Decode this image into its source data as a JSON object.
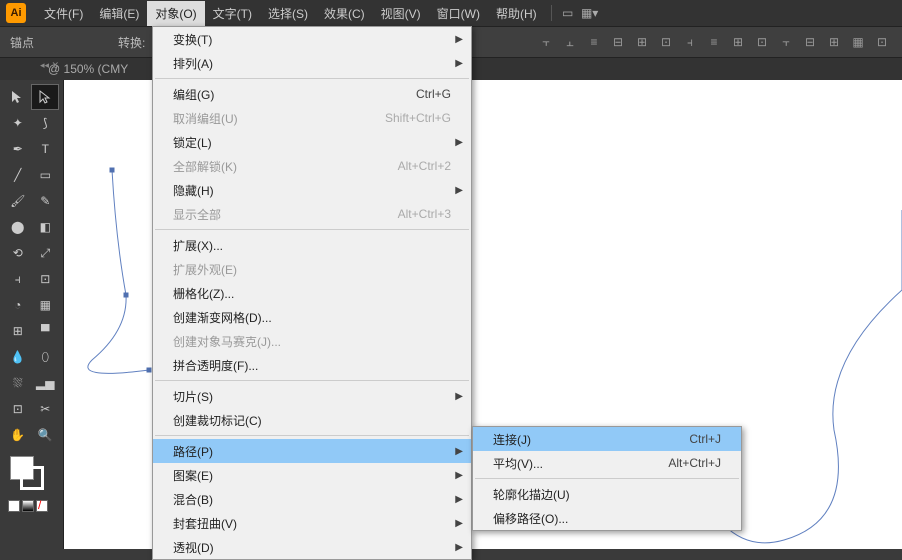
{
  "app": {
    "logo": "Ai"
  },
  "menubar": {
    "items": [
      "文件(F)",
      "编辑(E)",
      "对象(O)",
      "文字(T)",
      "选择(S)",
      "效果(C)",
      "视图(V)",
      "窗口(W)",
      "帮助(H)"
    ],
    "active_index": 2
  },
  "optionbar": {
    "anchor_label": "锚点",
    "convert_label": "转换:"
  },
  "tab": {
    "title": "@ 150% (CMY"
  },
  "dropdown": {
    "groups": [
      [
        {
          "label": "变换(T)",
          "shortcut": "",
          "arrow": true,
          "disabled": false
        },
        {
          "label": "排列(A)",
          "shortcut": "",
          "arrow": true,
          "disabled": false
        }
      ],
      [
        {
          "label": "编组(G)",
          "shortcut": "Ctrl+G",
          "arrow": false,
          "disabled": false
        },
        {
          "label": "取消编组(U)",
          "shortcut": "Shift+Ctrl+G",
          "arrow": false,
          "disabled": true
        },
        {
          "label": "锁定(L)",
          "shortcut": "",
          "arrow": true,
          "disabled": false
        },
        {
          "label": "全部解锁(K)",
          "shortcut": "Alt+Ctrl+2",
          "arrow": false,
          "disabled": true
        },
        {
          "label": "隐藏(H)",
          "shortcut": "",
          "arrow": true,
          "disabled": false
        },
        {
          "label": "显示全部",
          "shortcut": "Alt+Ctrl+3",
          "arrow": false,
          "disabled": true
        }
      ],
      [
        {
          "label": "扩展(X)...",
          "shortcut": "",
          "arrow": false,
          "disabled": false
        },
        {
          "label": "扩展外观(E)",
          "shortcut": "",
          "arrow": false,
          "disabled": true
        },
        {
          "label": "栅格化(Z)...",
          "shortcut": "",
          "arrow": false,
          "disabled": false
        },
        {
          "label": "创建渐变网格(D)...",
          "shortcut": "",
          "arrow": false,
          "disabled": false
        },
        {
          "label": "创建对象马赛克(J)...",
          "shortcut": "",
          "arrow": false,
          "disabled": true
        },
        {
          "label": "拼合透明度(F)...",
          "shortcut": "",
          "arrow": false,
          "disabled": false
        }
      ],
      [
        {
          "label": "切片(S)",
          "shortcut": "",
          "arrow": true,
          "disabled": false
        },
        {
          "label": "创建裁切标记(C)",
          "shortcut": "",
          "arrow": false,
          "disabled": false
        }
      ],
      [
        {
          "label": "路径(P)",
          "shortcut": "",
          "arrow": true,
          "disabled": false,
          "highlight": true
        },
        {
          "label": "图案(E)",
          "shortcut": "",
          "arrow": true,
          "disabled": false
        },
        {
          "label": "混合(B)",
          "shortcut": "",
          "arrow": true,
          "disabled": false
        },
        {
          "label": "封套扭曲(V)",
          "shortcut": "",
          "arrow": true,
          "disabled": false
        },
        {
          "label": "透视(D)",
          "shortcut": "",
          "arrow": true,
          "disabled": false
        }
      ]
    ]
  },
  "submenu": {
    "groups": [
      [
        {
          "label": "连接(J)",
          "shortcut": "Ctrl+J",
          "highlight": true
        },
        {
          "label": "平均(V)...",
          "shortcut": "Alt+Ctrl+J"
        }
      ],
      [
        {
          "label": "轮廓化描边(U)",
          "shortcut": ""
        },
        {
          "label": "偏移路径(O)...",
          "shortcut": ""
        }
      ]
    ]
  }
}
